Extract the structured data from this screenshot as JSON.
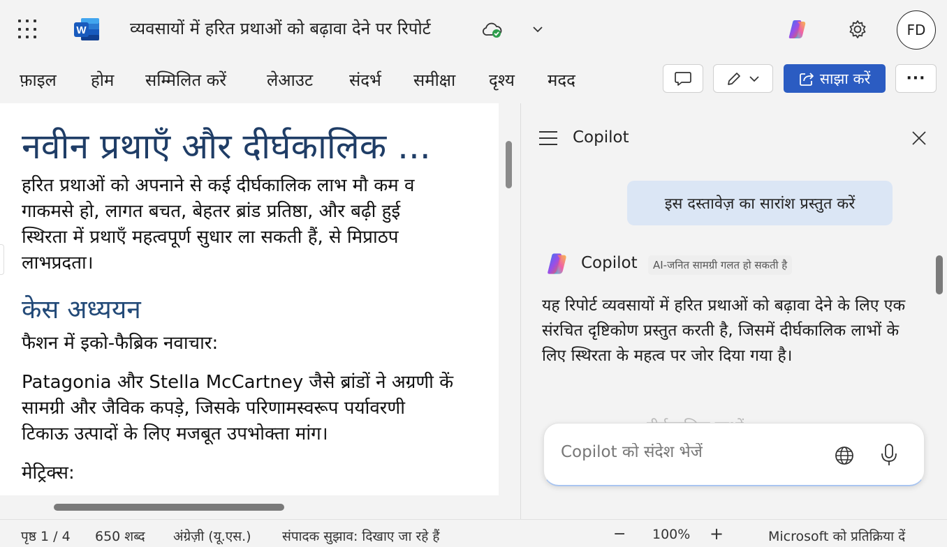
{
  "titlebar": {
    "doc_title": "व्यवसायों में हरित प्रथाओं को बढ़ावा देने पर रिपोर्ट",
    "avatar_initials": "FD"
  },
  "menu": {
    "items": [
      {
        "label": "फ़ाइल"
      },
      {
        "label": "होम"
      },
      {
        "label": "सम्मिलित करें"
      },
      {
        "label": "लेआउट"
      },
      {
        "label": "संदर्भ"
      },
      {
        "label": "समीक्षा"
      },
      {
        "label": "दृश्य"
      },
      {
        "label": "मदद"
      }
    ],
    "share_label": "साझा करें",
    "more_label": "···"
  },
  "document": {
    "heading": "नवीन प्रथाएँ और दीर्घकालिक ...",
    "para1": [
      "हरित प्रथाओं को अपनाने से कई दीर्घकालिक लाभ मौ कम व",
      "गाकमसे हो, लागत बचत, बेहतर ब्रांड प्रतिष्ठा, और बढ़ी हुई",
      "स्थिरता में प्रथाएँ महत्वपूर्ण सुधार ला सकती हैं, से मिप्राठप",
      "लाभप्रदता।"
    ],
    "subheading": "केस अध्ययन",
    "case_title": "फैशन में इको-फैब्रिक नवाचार:",
    "para2": [
      "Patagonia और Stella McCartney जैसे ब्रांडों ने अग्रणी कें",
      "सामग्री और जैविक कपड़े, जिसके परिणामस्वरूप पर्यावरणी",
      "टिकाऊ उत्पादों के लिए मजबूत उपभोक्ता मांग।"
    ],
    "metrics_label": "मेट्रिक्स:"
  },
  "copilot": {
    "title": "Copilot",
    "user_prompt": "इस दस्तावेज़ का सारांश प्रस्तुत करें",
    "assistant_name": "Copilot",
    "ai_badge": "AI-जनित सामग्री गलत हो सकती है",
    "answer": "यह रिपोर्ट व्यवसायों में हरित प्रथाओं को बढ़ावा देने के लिए एक संरचित दृष्टिकोण प्रस्तुत करती है, जिसमें दीर्घकालिक लाभों के लिए स्थिरता के महत्व पर जोर दिया गया है।",
    "faded_text": "दीर्घकालिक लाभों",
    "composer_placeholder": "Copilot को संदेश भेजें"
  },
  "statusbar": {
    "page": "पृष्ठ 1 / 4",
    "words": "650 शब्द",
    "language": "अंग्रेज़ी (यू.एस.)",
    "editor": "संपादक सुझाव: दिखाए जा रहे हैं",
    "zoom": "100%",
    "feedback": "Microsoft को प्रतिक्रिया दें"
  },
  "colors": {
    "accent": "#2b5cc2",
    "heading": "#1f3d66",
    "bubble": "#dbe6f5"
  }
}
